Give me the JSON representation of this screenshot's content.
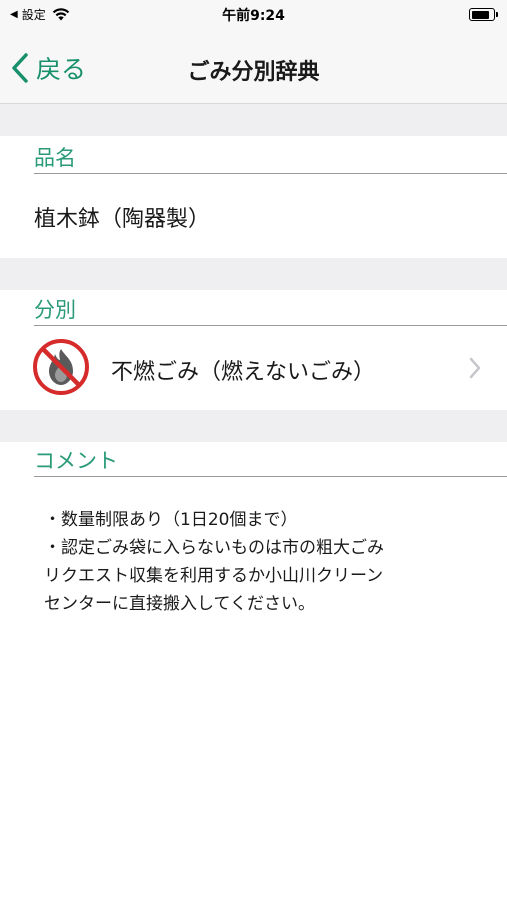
{
  "status_bar": {
    "back_label": "設定",
    "time": "午前9:24",
    "battery_level": 0.85
  },
  "nav": {
    "back_label": "戻る",
    "title": "ごみ分別辞典"
  },
  "item_section": {
    "header": "品名",
    "value": "植木鉢（陶器製）"
  },
  "category_section": {
    "header": "分別",
    "label": "不燃ごみ（燃えないごみ）",
    "icon": "no-burn-icon"
  },
  "comment_section": {
    "header": "コメント",
    "lines": [
      "・数量制限あり（1日20個まで）",
      "・認定ごみ袋に入らないものは市の粗大ごみ",
      "リクエスト収集を利用するか小山川クリーン",
      "センターに直接搬入してください。"
    ]
  },
  "colors": {
    "accent": "#2a9a78",
    "prohibit_red": "#d62b2b",
    "separator": "#efeff2"
  }
}
